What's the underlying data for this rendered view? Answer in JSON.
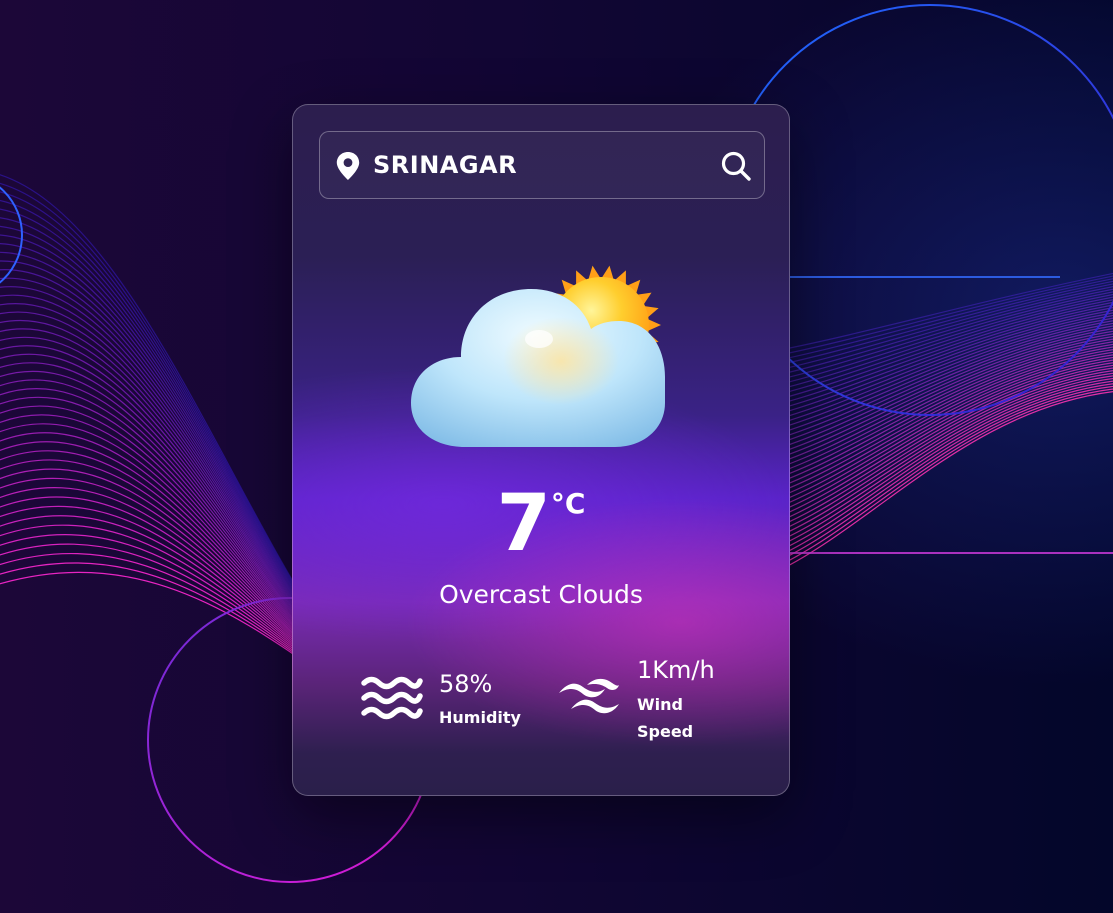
{
  "search": {
    "city": "SRINAGAR"
  },
  "weather": {
    "temperature": "7",
    "unit": "°C",
    "description": "Overcast Clouds",
    "condition_icon": "cloud-sun-icon"
  },
  "stats": {
    "humidity": {
      "value": "58%",
      "label": "Humidity",
      "icon": "waves-icon"
    },
    "wind": {
      "value": "1Km/h",
      "label_line1": "Wind",
      "label_line2": "Speed",
      "icon": "wind-icon"
    }
  },
  "colors": {
    "background": "#0b0630",
    "accent_magenta": "#e51ad8",
    "accent_violet": "#6a2bd6",
    "sun": "#ffb21a",
    "cloud": "#a9d8f5"
  }
}
